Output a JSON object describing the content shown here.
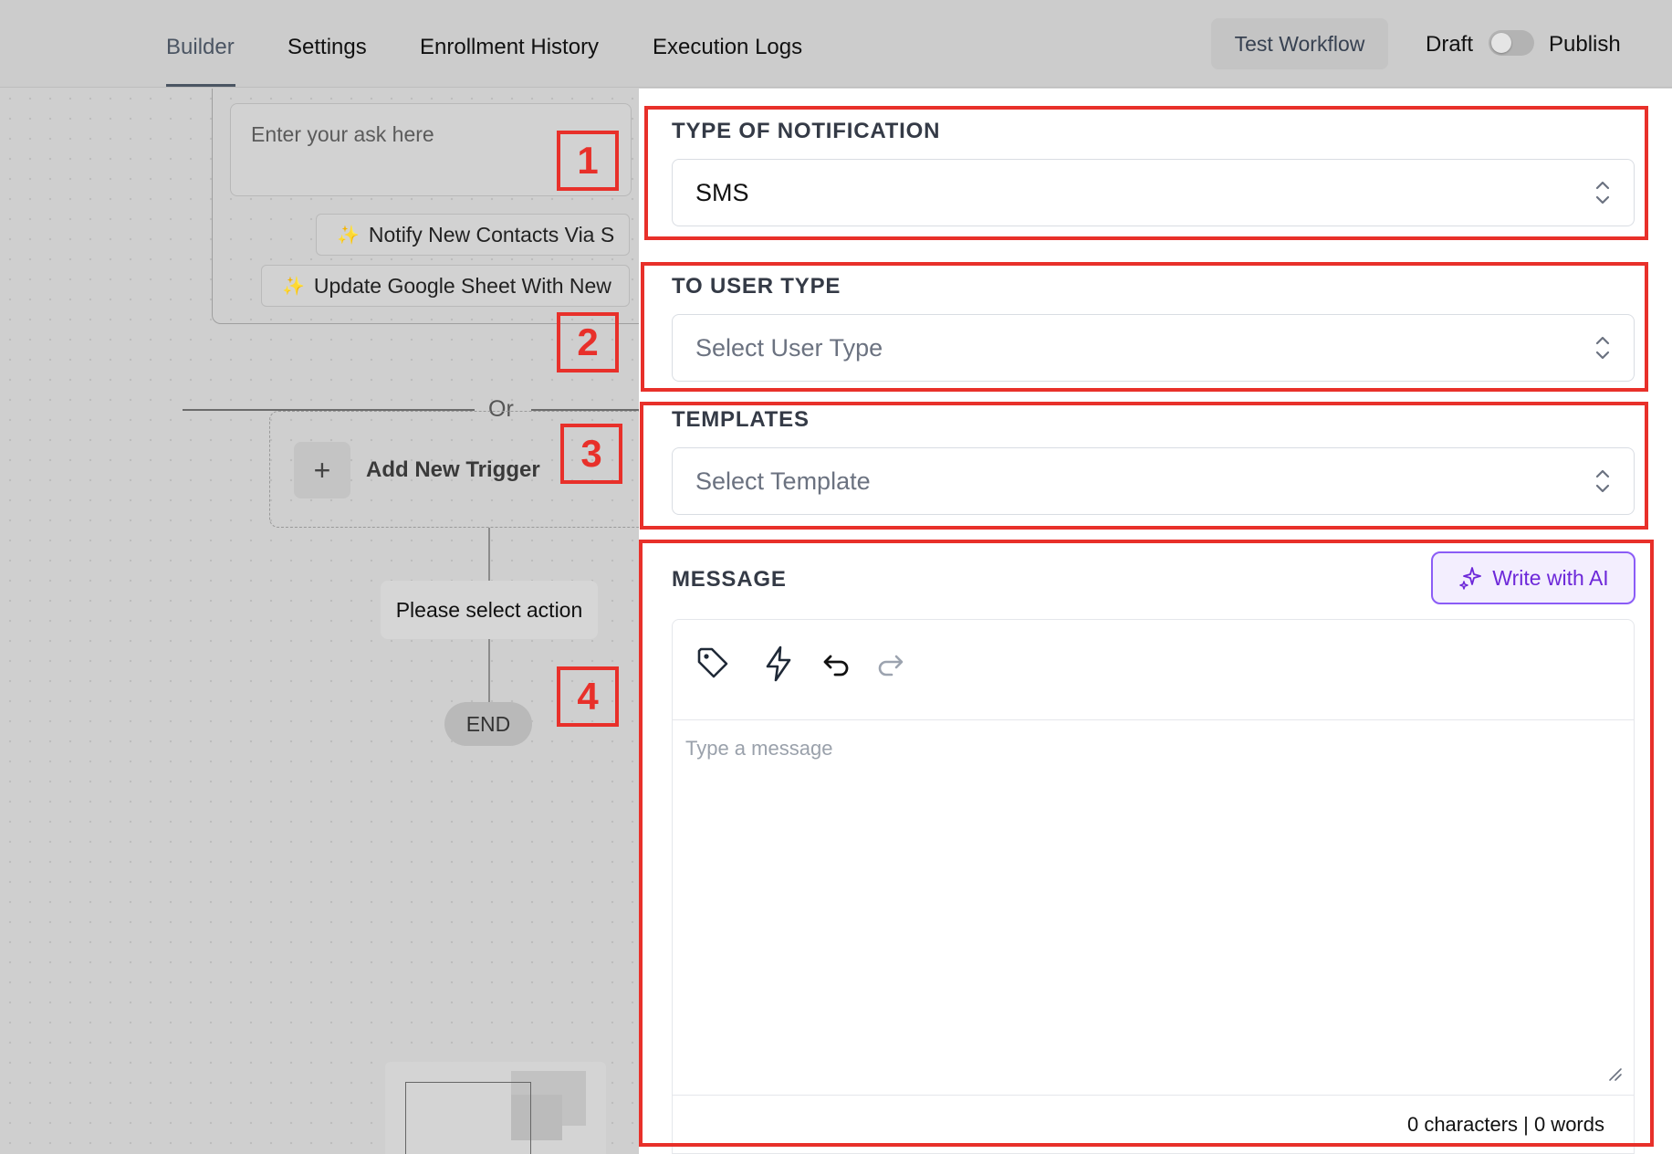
{
  "nav": {
    "tabs": [
      {
        "label": "Builder",
        "active": true
      },
      {
        "label": "Settings"
      },
      {
        "label": "Enrollment History"
      },
      {
        "label": "Execution Logs"
      }
    ],
    "test_button": "Test Workflow",
    "draft_label": "Draft",
    "publish_label": "Publish",
    "publish_toggle_on": false
  },
  "canvas": {
    "ask_placeholder": "Enter your ask here",
    "suggestions": [
      "Notify New Contacts Via S",
      "Update Google Sheet With New"
    ],
    "or_label": "Or",
    "add_trigger_label": "Add New Trigger",
    "add_trigger_icon": "+",
    "select_action_label": "Please select action",
    "end_label": "END"
  },
  "markers": [
    "1",
    "2",
    "3",
    "4"
  ],
  "panel": {
    "notification": {
      "label": "TYPE OF NOTIFICATION",
      "value": "SMS"
    },
    "user_type": {
      "label": "TO USER TYPE",
      "placeholder": "Select User Type"
    },
    "templates": {
      "label": "TEMPLATES",
      "placeholder": "Select Template"
    },
    "message": {
      "label": "MESSAGE",
      "ai_button": "Write with AI",
      "placeholder": "Type a message",
      "counter": "0 characters | 0 words",
      "toolbar_icons": [
        "tag-icon",
        "lightning-icon",
        "undo-icon",
        "redo-icon"
      ]
    }
  },
  "colors": {
    "highlight": "#e8302a",
    "ai_accent": "#8b5cf6"
  }
}
